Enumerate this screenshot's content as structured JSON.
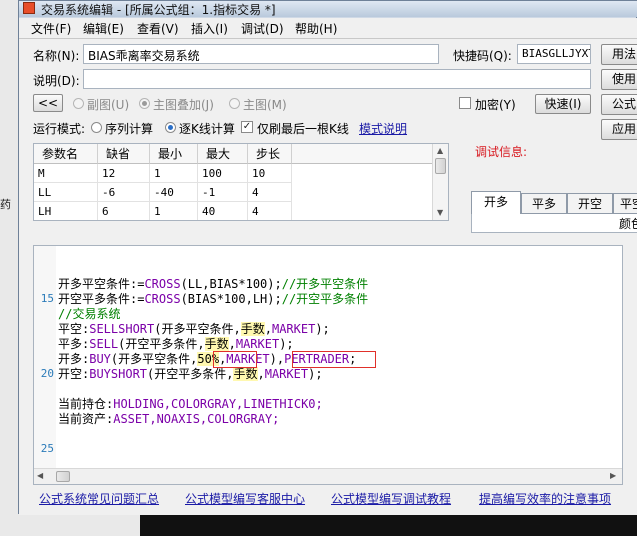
{
  "desktop": {
    "left_text": "药"
  },
  "window": {
    "title": "交易系统编辑 - [所属公式组：1.指标交易 *]"
  },
  "menu": {
    "items": [
      "文件(F)",
      "编辑(E)",
      "查看(V)",
      "插入(I)",
      "调试(D)",
      "帮助(H)"
    ]
  },
  "form": {
    "name_label": "名称(N):",
    "name_value": "BIAS乖离率交易系统",
    "shortcut_label": "快捷码(Q):",
    "shortcut_value": "BIASGLLJYXT",
    "desc_label": "说明(D):",
    "desc_value": "",
    "nav_button": "<<",
    "radio_sub": "副图(U)",
    "radio_main_overlay": "主图叠加(J)",
    "radio_main": "主图(M)",
    "encrypt_label": "加密(Y)",
    "fast_button": "快速(I)",
    "run_mode_label": "运行模式:",
    "run_seq": "序列计算",
    "run_bar": "逐K线计算",
    "refresh_last": "仅刷最后一根K线",
    "mode_link": "模式说明"
  },
  "right_buttons": [
    "用法",
    "使用",
    "公式",
    "应用"
  ],
  "params": {
    "headers": [
      "参数名",
      "缺省",
      "最小",
      "最大",
      "步长"
    ],
    "rows": [
      [
        "M",
        "12",
        "1",
        "100",
        "10"
      ],
      [
        "LL",
        "-6",
        "-40",
        "-1",
        "4"
      ],
      [
        "LH",
        "6",
        "1",
        "40",
        "4"
      ]
    ]
  },
  "debug": {
    "label": "调试信息:",
    "tabs": [
      "开多",
      "平多",
      "开空",
      "平空"
    ],
    "column_header": "颜色"
  },
  "code": {
    "line_numbers": [
      "15",
      "20",
      "25"
    ],
    "lines": {
      "l1_a": "开多平空条件:=",
      "l1_b": "CROSS",
      "l1_c": "(LL,BIAS*100);",
      "l1_d": "//开多平空条件",
      "l2_a": "开空平多条件:=",
      "l2_b": "CROSS",
      "l2_c": "(BIAS*100,LH);",
      "l2_d": "//开空平多条件",
      "l3": "//交易系统",
      "l4_a": "平空:",
      "l4_b": "SELLSHORT",
      "l4_c": "(开多平空条件,",
      "l4_d": "手数",
      "l4_e": ",",
      "l4_f": "MARKET",
      "l4_g": ");",
      "l5_a": "平多:",
      "l5_b": "SELL",
      "l5_c": "(开空平多条件,",
      "l5_d": "手数",
      "l5_e": ",",
      "l5_f": "MARKET",
      "l5_g": ");",
      "l6_a": "开多:",
      "l6_b": "BUY",
      "l6_c": "(开多平空条件,",
      "l6_d": "50%",
      "l6_e": ",",
      "l6_f": "MARKET",
      "l6_g": "),",
      "l6_h": "PERTRADER",
      "l6_i": ";",
      "l7_a": "开空:",
      "l7_b": "BUYSHORT",
      "l7_c": "(开空平多条件,",
      "l7_d": "手数",
      "l7_e": ",",
      "l7_f": "MARKET",
      "l7_g": ");",
      "l8_a": "当前持仓:",
      "l8_b": "HOLDING,COLORGRAY,LINETHICK0;",
      "l9_a": "当前资产:",
      "l9_b": "ASSET,NOAXIS,COLORGRAY;"
    }
  },
  "footer_links": [
    "公式系统常见问题汇总",
    "公式模型编写客服中心",
    "公式模型编写调试教程",
    "提高编写效率的注意事项"
  ],
  "colors": {
    "code_comment": "#008000",
    "code_function": "#7b00a8",
    "highlight": "#fff8b0",
    "error_box": "#e0302a",
    "debug_label": "#d8181f"
  }
}
